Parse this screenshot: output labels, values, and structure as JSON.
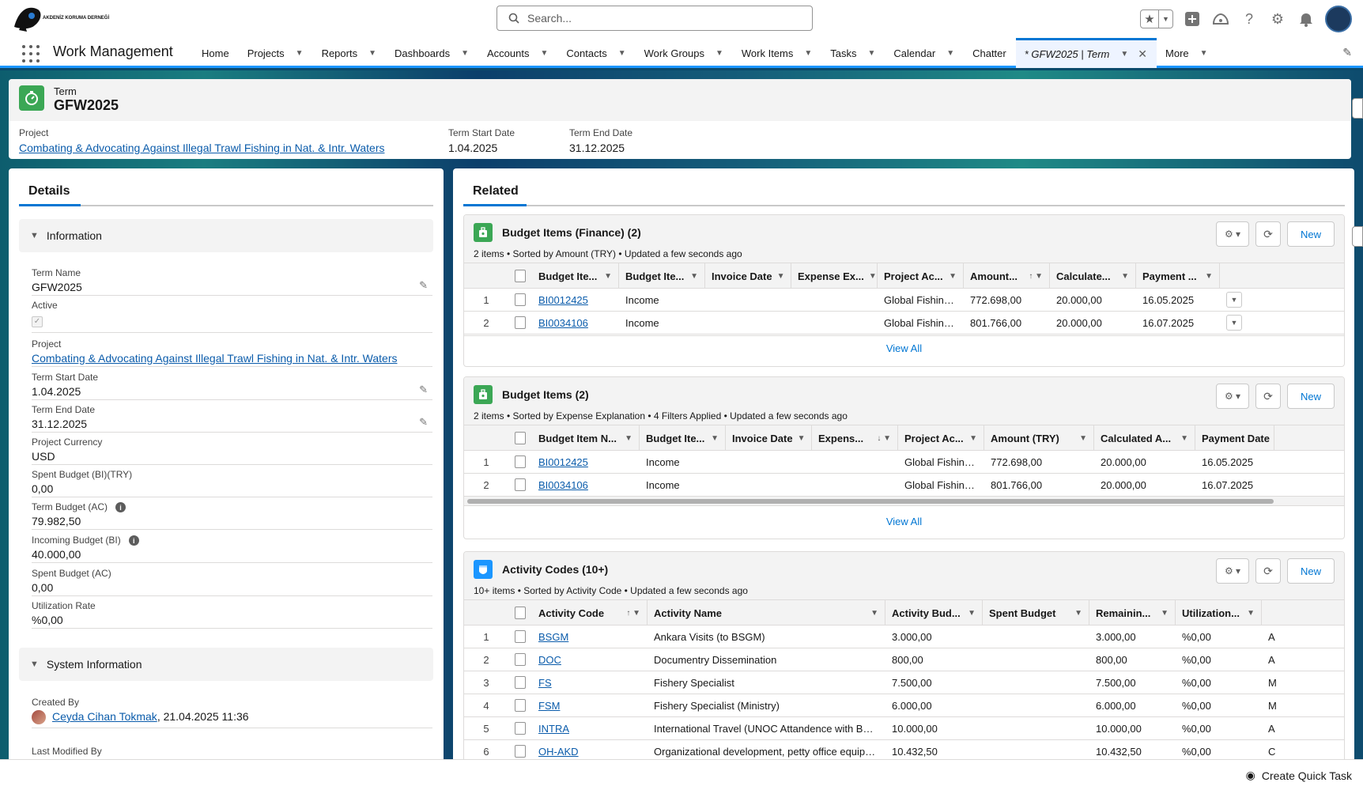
{
  "header": {
    "org_name": "AKDENİZ KORUMA DERNEĞİ",
    "search_placeholder": "Search..."
  },
  "nav": {
    "app_name": "Work Management",
    "items": [
      {
        "label": "Home",
        "has_menu": false
      },
      {
        "label": "Projects",
        "has_menu": true
      },
      {
        "label": "Reports",
        "has_menu": true
      },
      {
        "label": "Dashboards",
        "has_menu": true
      },
      {
        "label": "Accounts",
        "has_menu": true
      },
      {
        "label": "Contacts",
        "has_menu": true
      },
      {
        "label": "Work Groups",
        "has_menu": true
      },
      {
        "label": "Work Items",
        "has_menu": true
      },
      {
        "label": "Tasks",
        "has_menu": true
      },
      {
        "label": "Calendar",
        "has_menu": true
      },
      {
        "label": "Chatter",
        "has_menu": false
      }
    ],
    "active_tab": "* GFW2025 | Term",
    "more": "More"
  },
  "record": {
    "type": "Term",
    "title": "GFW2025",
    "project_label": "Project",
    "project_value": "Combating & Advocating Against Illegal Trawl Fishing in Nat. & Intr. Waters",
    "start_label": "Term Start Date",
    "start_value": "1.04.2025",
    "end_label": "Term End Date",
    "end_value": "31.12.2025"
  },
  "details": {
    "tab": "Details",
    "info_section": "Information",
    "fields": {
      "term_name": {
        "label": "Term Name",
        "value": "GFW2025"
      },
      "active": {
        "label": "Active"
      },
      "project": {
        "label": "Project",
        "value": "Combating & Advocating Against Illegal Trawl Fishing in Nat. & Intr. Waters"
      },
      "start": {
        "label": "Term Start Date",
        "value": "1.04.2025"
      },
      "end": {
        "label": "Term End Date",
        "value": "31.12.2025"
      },
      "currency": {
        "label": "Project Currency",
        "value": "USD"
      },
      "spent_bi": {
        "label": "Spent Budget (BI)(TRY)",
        "value": "0,00"
      },
      "term_budget": {
        "label": "Term Budget (AC)",
        "value": "79.982,50"
      },
      "incoming": {
        "label": "Incoming Budget (BI)",
        "value": "40.000,00"
      },
      "spent_ac": {
        "label": "Spent Budget (AC)",
        "value": "0,00"
      },
      "utilization": {
        "label": "Utilization Rate",
        "value": "%0,00"
      }
    },
    "system_section": "System Information",
    "created_by_label": "Created By",
    "created_by_user": "Ceyda Cihan Tokmak",
    "created_by_date": ", 21.04.2025 11:36",
    "last_modified_label": "Last Modified By"
  },
  "related": {
    "tab": "Related",
    "new_label": "New",
    "view_all": "View All",
    "finance": {
      "title": "Budget Items (Finance) (2)",
      "subtitle": "2 items • Sorted by Amount (TRY) • Updated a few seconds ago",
      "columns": [
        "Budget Ite...",
        "Budget Ite...",
        "Invoice Date",
        "Expense Ex...",
        "Project Ac...",
        "Amount...",
        "Calculate...",
        "Payment ..."
      ],
      "rows": [
        {
          "n": "1",
          "id": "BI0012425",
          "type": "Income",
          "invoice": "",
          "expense": "",
          "project": "Global Fishing ...",
          "amount": "772.698,00",
          "calc": "20.000,00",
          "payment": "16.05.2025"
        },
        {
          "n": "2",
          "id": "BI0034106",
          "type": "Income",
          "invoice": "",
          "expense": "",
          "project": "Global Fishing ...",
          "amount": "801.766,00",
          "calc": "20.000,00",
          "payment": "16.07.2025"
        }
      ]
    },
    "budget": {
      "title": "Budget Items (2)",
      "subtitle": "2 items • Sorted by Expense Explanation • 4 Filters Applied • Updated a few seconds ago",
      "columns": [
        "Budget Item N...",
        "Budget Ite...",
        "Invoice Date",
        "Expens...",
        "Project Ac...",
        "Amount (TRY)",
        "Calculated A...",
        "Payment Date"
      ],
      "rows": [
        {
          "n": "1",
          "id": "BI0012425",
          "type": "Income",
          "invoice": "",
          "expense": "",
          "project": "Global Fishing ...",
          "amount": "772.698,00",
          "calc": "20.000,00",
          "payment": "16.05.2025"
        },
        {
          "n": "2",
          "id": "BI0034106",
          "type": "Income",
          "invoice": "",
          "expense": "",
          "project": "Global Fishing ...",
          "amount": "801.766,00",
          "calc": "20.000,00",
          "payment": "16.07.2025"
        }
      ]
    },
    "activity": {
      "title": "Activity Codes (10+)",
      "subtitle": "10+ items • Sorted by Activity Code • Updated a few seconds ago",
      "columns": [
        "Activity Code",
        "Activity Name",
        "Activity Bud...",
        "Spent Budget",
        "Remainin...",
        "Utilization..."
      ],
      "rows": [
        {
          "n": "1",
          "code": "BSGM",
          "name": "Ankara Visits (to BSGM)",
          "budget": "3.000,00",
          "spent": "",
          "remain": "3.000,00",
          "util": "%0,00",
          "extra": "A"
        },
        {
          "n": "2",
          "code": "DOC",
          "name": "Documentry Dissemination",
          "budget": "800,00",
          "spent": "",
          "remain": "800,00",
          "util": "%0,00",
          "extra": "A"
        },
        {
          "n": "3",
          "code": "FS",
          "name": "Fishery Specialist",
          "budget": "7.500,00",
          "spent": "",
          "remain": "7.500,00",
          "util": "%0,00",
          "extra": "M"
        },
        {
          "n": "4",
          "code": "FSM",
          "name": "Fishery Specialist (Ministry)",
          "budget": "6.000,00",
          "spent": "",
          "remain": "6.000,00",
          "util": "%0,00",
          "extra": "M"
        },
        {
          "n": "5",
          "code": "INTRA",
          "name": "International Travel (UNOC Attandence with BSG...",
          "budget": "10.000,00",
          "spent": "",
          "remain": "10.000,00",
          "util": "%0,00",
          "extra": "A"
        },
        {
          "n": "6",
          "code": "OH-AKD",
          "name": "Organizational development, petty office equipme...",
          "budget": "10.432,50",
          "spent": "",
          "remain": "10.432,50",
          "util": "%0,00",
          "extra": "C"
        }
      ]
    }
  },
  "footer": {
    "quick_task": "Create Quick Task"
  },
  "colors": {
    "brand_blue": "#0176d3",
    "record_icon": "#3ba755",
    "activity_icon": "#1b96ff"
  }
}
